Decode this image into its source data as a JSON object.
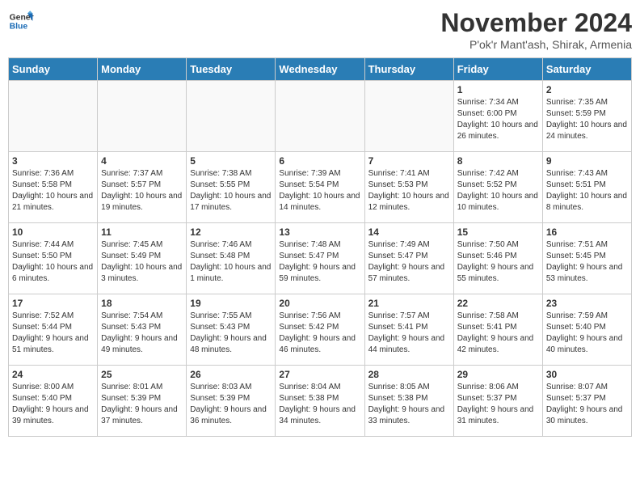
{
  "header": {
    "logo_line1": "General",
    "logo_line2": "Blue",
    "month": "November 2024",
    "location": "P'ok'r Mant'ash, Shirak, Armenia"
  },
  "days_of_week": [
    "Sunday",
    "Monday",
    "Tuesday",
    "Wednesday",
    "Thursday",
    "Friday",
    "Saturday"
  ],
  "weeks": [
    [
      {
        "day": "",
        "info": ""
      },
      {
        "day": "",
        "info": ""
      },
      {
        "day": "",
        "info": ""
      },
      {
        "day": "",
        "info": ""
      },
      {
        "day": "",
        "info": ""
      },
      {
        "day": "1",
        "info": "Sunrise: 7:34 AM\nSunset: 6:00 PM\nDaylight: 10 hours and 26 minutes."
      },
      {
        "day": "2",
        "info": "Sunrise: 7:35 AM\nSunset: 5:59 PM\nDaylight: 10 hours and 24 minutes."
      }
    ],
    [
      {
        "day": "3",
        "info": "Sunrise: 7:36 AM\nSunset: 5:58 PM\nDaylight: 10 hours and 21 minutes."
      },
      {
        "day": "4",
        "info": "Sunrise: 7:37 AM\nSunset: 5:57 PM\nDaylight: 10 hours and 19 minutes."
      },
      {
        "day": "5",
        "info": "Sunrise: 7:38 AM\nSunset: 5:55 PM\nDaylight: 10 hours and 17 minutes."
      },
      {
        "day": "6",
        "info": "Sunrise: 7:39 AM\nSunset: 5:54 PM\nDaylight: 10 hours and 14 minutes."
      },
      {
        "day": "7",
        "info": "Sunrise: 7:41 AM\nSunset: 5:53 PM\nDaylight: 10 hours and 12 minutes."
      },
      {
        "day": "8",
        "info": "Sunrise: 7:42 AM\nSunset: 5:52 PM\nDaylight: 10 hours and 10 minutes."
      },
      {
        "day": "9",
        "info": "Sunrise: 7:43 AM\nSunset: 5:51 PM\nDaylight: 10 hours and 8 minutes."
      }
    ],
    [
      {
        "day": "10",
        "info": "Sunrise: 7:44 AM\nSunset: 5:50 PM\nDaylight: 10 hours and 6 minutes."
      },
      {
        "day": "11",
        "info": "Sunrise: 7:45 AM\nSunset: 5:49 PM\nDaylight: 10 hours and 3 minutes."
      },
      {
        "day": "12",
        "info": "Sunrise: 7:46 AM\nSunset: 5:48 PM\nDaylight: 10 hours and 1 minute."
      },
      {
        "day": "13",
        "info": "Sunrise: 7:48 AM\nSunset: 5:47 PM\nDaylight: 9 hours and 59 minutes."
      },
      {
        "day": "14",
        "info": "Sunrise: 7:49 AM\nSunset: 5:47 PM\nDaylight: 9 hours and 57 minutes."
      },
      {
        "day": "15",
        "info": "Sunrise: 7:50 AM\nSunset: 5:46 PM\nDaylight: 9 hours and 55 minutes."
      },
      {
        "day": "16",
        "info": "Sunrise: 7:51 AM\nSunset: 5:45 PM\nDaylight: 9 hours and 53 minutes."
      }
    ],
    [
      {
        "day": "17",
        "info": "Sunrise: 7:52 AM\nSunset: 5:44 PM\nDaylight: 9 hours and 51 minutes."
      },
      {
        "day": "18",
        "info": "Sunrise: 7:54 AM\nSunset: 5:43 PM\nDaylight: 9 hours and 49 minutes."
      },
      {
        "day": "19",
        "info": "Sunrise: 7:55 AM\nSunset: 5:43 PM\nDaylight: 9 hours and 48 minutes."
      },
      {
        "day": "20",
        "info": "Sunrise: 7:56 AM\nSunset: 5:42 PM\nDaylight: 9 hours and 46 minutes."
      },
      {
        "day": "21",
        "info": "Sunrise: 7:57 AM\nSunset: 5:41 PM\nDaylight: 9 hours and 44 minutes."
      },
      {
        "day": "22",
        "info": "Sunrise: 7:58 AM\nSunset: 5:41 PM\nDaylight: 9 hours and 42 minutes."
      },
      {
        "day": "23",
        "info": "Sunrise: 7:59 AM\nSunset: 5:40 PM\nDaylight: 9 hours and 40 minutes."
      }
    ],
    [
      {
        "day": "24",
        "info": "Sunrise: 8:00 AM\nSunset: 5:40 PM\nDaylight: 9 hours and 39 minutes."
      },
      {
        "day": "25",
        "info": "Sunrise: 8:01 AM\nSunset: 5:39 PM\nDaylight: 9 hours and 37 minutes."
      },
      {
        "day": "26",
        "info": "Sunrise: 8:03 AM\nSunset: 5:39 PM\nDaylight: 9 hours and 36 minutes."
      },
      {
        "day": "27",
        "info": "Sunrise: 8:04 AM\nSunset: 5:38 PM\nDaylight: 9 hours and 34 minutes."
      },
      {
        "day": "28",
        "info": "Sunrise: 8:05 AM\nSunset: 5:38 PM\nDaylight: 9 hours and 33 minutes."
      },
      {
        "day": "29",
        "info": "Sunrise: 8:06 AM\nSunset: 5:37 PM\nDaylight: 9 hours and 31 minutes."
      },
      {
        "day": "30",
        "info": "Sunrise: 8:07 AM\nSunset: 5:37 PM\nDaylight: 9 hours and 30 minutes."
      }
    ]
  ]
}
